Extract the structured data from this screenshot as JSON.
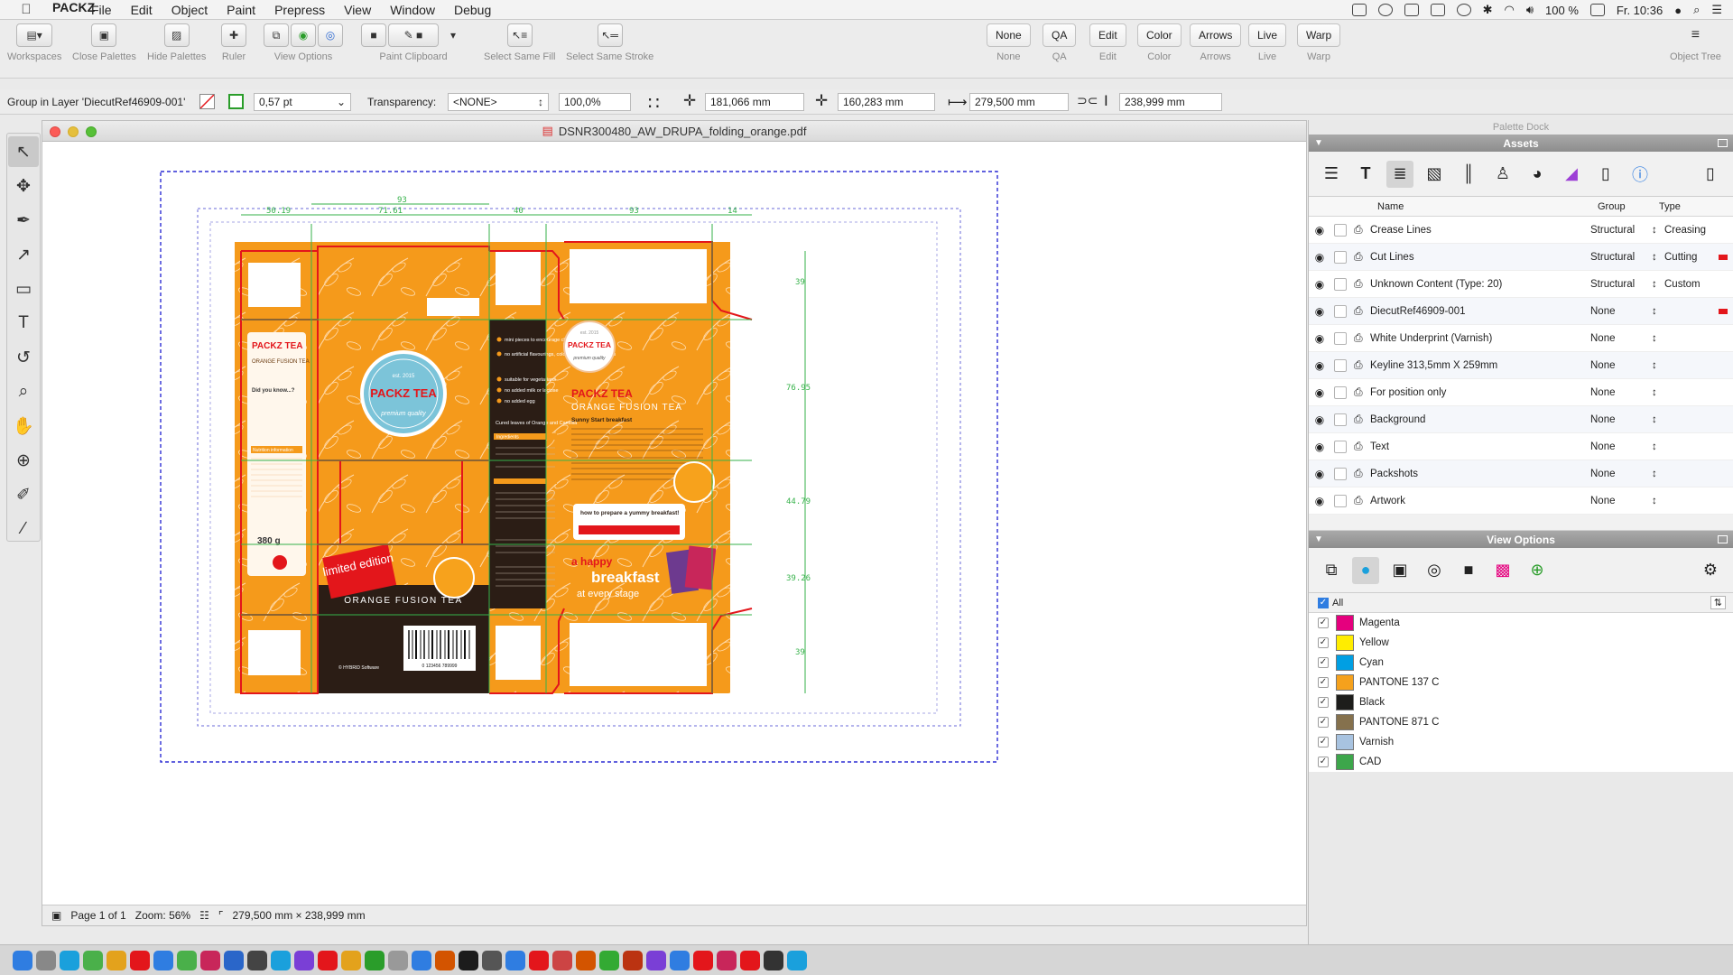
{
  "menubar": {
    "app_name": "PACKZ",
    "items": [
      "File",
      "Edit",
      "Object",
      "Paint",
      "Prepress",
      "View",
      "Window",
      "Debug"
    ],
    "battery": "100 %",
    "clock": "Fr. 10:36"
  },
  "toolbar": {
    "groups": [
      {
        "label": "Workspaces"
      },
      {
        "label": "Close Palettes"
      },
      {
        "label": "Hide Palettes"
      },
      {
        "label": "Ruler"
      },
      {
        "label": "View Options"
      },
      {
        "label": "Paint Clipboard"
      },
      {
        "label": "Select Same Fill"
      },
      {
        "label": "Select Same Stroke"
      }
    ],
    "text_buttons": [
      {
        "label": "None",
        "sub": "None"
      },
      {
        "label": "QA",
        "sub": "QA"
      },
      {
        "label": "Edit",
        "sub": "Edit"
      },
      {
        "label": "Color",
        "sub": "Color"
      },
      {
        "label": "Arrows",
        "sub": "Arrows"
      },
      {
        "label": "Live",
        "sub": "Live"
      },
      {
        "label": "Warp",
        "sub": "Warp"
      }
    ],
    "object_tree_label": "Object Tree"
  },
  "propbar": {
    "selection": "Group in Layer 'DiecutRef46909-001'",
    "stroke_width": "0,57 pt",
    "transparency_label": "Transparency:",
    "transparency_mode": "<NONE>",
    "opacity": "100,0%",
    "x": "181,066 mm",
    "y": "160,283 mm",
    "width": "279,500 mm",
    "height": "238,999 mm"
  },
  "document": {
    "title": "DSNR300480_AW_DRUPA_folding_orange.pdf",
    "page": "Page 1 of 1",
    "zoom": "Zoom: 56%",
    "dimensions": "279,500 mm × 238,999 mm"
  },
  "artwork": {
    "dims_top": [
      "50.19",
      "93",
      "71.61",
      "40",
      "93",
      "14"
    ],
    "dims_right": [
      "39",
      "76.95",
      "44.79",
      "39.26",
      "39"
    ],
    "brand": "PACKZ TEA",
    "est": "est. 2015",
    "premium": "premium quality",
    "product": "ORANGE FUSION TEA",
    "limited": "limited edition",
    "front_title": "PACKZ TEA",
    "front_sub": "ORANGE FUSION TEA",
    "sunny": "Sunny Start breakfast",
    "howto": "how to prepare a yummy breakfast!",
    "happy": "a happy",
    "breakfast": "breakfast",
    "every": "at every stage",
    "weight": "380 g",
    "side_note": "Did you know...?",
    "nutrition": "Nutrition information",
    "bullets": [
      "mini pieces to encourage chewing",
      "no artificial flavourings, colourings or preservatives",
      "suitable for vegetarians",
      "no added milk or lactose",
      "no added egg"
    ],
    "cured": "Cured leaves of Orange and Camillia",
    "ingredients": "Ingredients",
    "hybrid": "© HYBRID Software",
    "barcode": "0 123456 789999"
  },
  "dock": {
    "title": "Palette Dock",
    "assets_title": "Assets",
    "columns": [
      "Name",
      "Group",
      "Type"
    ],
    "rows": [
      {
        "name": "Crease Lines",
        "group": "Structural",
        "type": "Creasing",
        "red": false
      },
      {
        "name": "Cut Lines",
        "group": "Structural",
        "type": "Cutting",
        "red": true
      },
      {
        "name": "Unknown Content (Type: 20)",
        "group": "Structural",
        "type": "Custom",
        "red": false
      },
      {
        "name": "DiecutRef46909-001",
        "group": "None",
        "type": "",
        "red": true
      },
      {
        "name": "White Underprint (Varnish)",
        "group": "None",
        "type": "",
        "red": false
      },
      {
        "name": "Keyline 313,5mm X 259mm",
        "group": "None",
        "type": "",
        "red": false
      },
      {
        "name": "For position only",
        "group": "None",
        "type": "",
        "red": false
      },
      {
        "name": "Background",
        "group": "None",
        "type": "",
        "red": false
      },
      {
        "name": "Text",
        "group": "None",
        "type": "",
        "red": false
      },
      {
        "name": "Packshots",
        "group": "None",
        "type": "",
        "red": false
      },
      {
        "name": "Artwork",
        "group": "None",
        "type": "",
        "red": false
      }
    ],
    "view_options_title": "View Options",
    "all_label": "All",
    "separations": [
      {
        "name": "Magenta",
        "color": "#e5007e"
      },
      {
        "name": "Yellow",
        "color": "#ffed00"
      },
      {
        "name": "Cyan",
        "color": "#009fe3"
      },
      {
        "name": "PANTONE 137 C",
        "color": "#f5a11c"
      },
      {
        "name": "Black",
        "color": "#1d1d1b"
      },
      {
        "name": "PANTONE 871 C",
        "color": "#85714d"
      },
      {
        "name": "Varnish",
        "color": "#a8c3e0"
      },
      {
        "name": "CAD",
        "color": "#3da64b"
      }
    ]
  },
  "colors": {
    "orange": "#f59a1b",
    "dark_brown": "#2b1d15",
    "cut_red": "#e3161b",
    "crease_green": "#36b24a",
    "bleed_blue": "#2d2dd4"
  }
}
